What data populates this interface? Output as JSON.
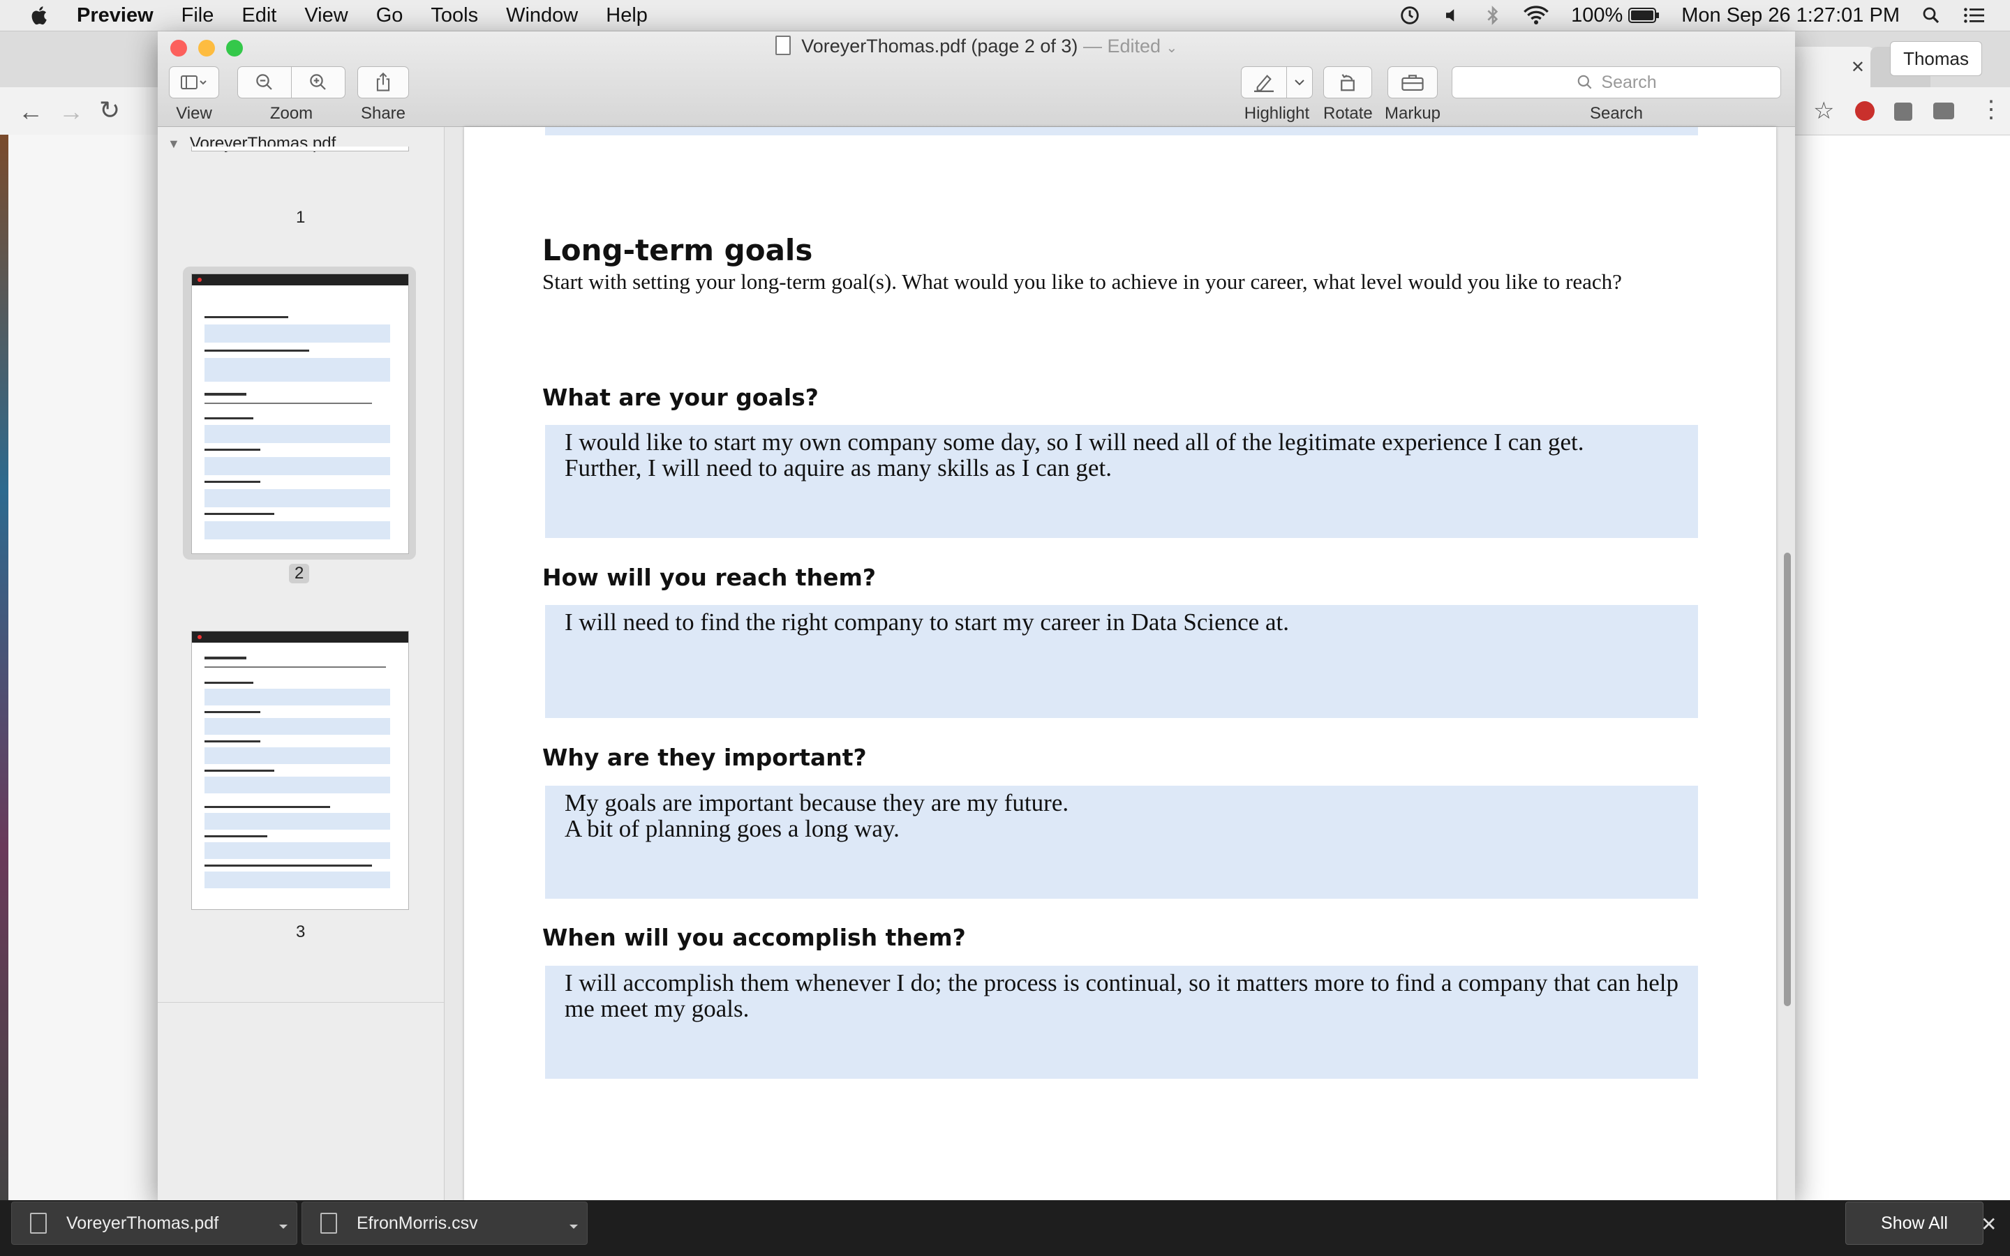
{
  "menubar": {
    "app_name": "Preview",
    "items": [
      "File",
      "Edit",
      "View",
      "Go",
      "Tools",
      "Window",
      "Help"
    ],
    "battery": "100%",
    "clock": "Mon Sep 26  1:27:01 PM",
    "user": "Thomas"
  },
  "window": {
    "title": "VoreyerThomas.pdf (page 2 of 3)",
    "edited": "— Edited"
  },
  "toolbar": {
    "view_label": "View",
    "zoom_label": "Zoom",
    "share_label": "Share",
    "highlight_label": "Highlight",
    "rotate_label": "Rotate",
    "markup_label": "Markup",
    "search_label": "Search",
    "search_placeholder": "Search"
  },
  "sidebar": {
    "document_name": "VoreyerThomas.pdf",
    "pages": [
      "1",
      "2",
      "3"
    ],
    "selected_page": "2"
  },
  "document": {
    "section_title": "Long-term goals",
    "intro": "Start with setting your long-term goal(s). What would you like to achieve in your career, what level would you like to reach?",
    "questions": [
      {
        "question": "What are your goals?",
        "answer": "I would like to start my own company some day, so I will need all of the legitimate experience I can get.\nFurther, I will need to aquire as many skills as I can get."
      },
      {
        "question": "How will you reach them?",
        "answer": "I will need to find the right company to start my career in Data Science at."
      },
      {
        "question": "Why are they important?",
        "answer": "My goals are important because they are my future.\nA bit of planning goes a long way."
      },
      {
        "question": "When will you accomplish them?",
        "answer": "I will accomplish them whenever I do; the process is continual, so it matters more to find a company that can help me meet my goals."
      }
    ]
  },
  "downloads": {
    "items": [
      "VoreyerThomas.pdf",
      "EfronMorris.csv"
    ],
    "show_all": "Show All"
  },
  "colors": {
    "answer_fill": "#dde8f7",
    "traffic_close": "#fc605c",
    "traffic_min": "#fdbc40",
    "traffic_max": "#34c84a"
  }
}
